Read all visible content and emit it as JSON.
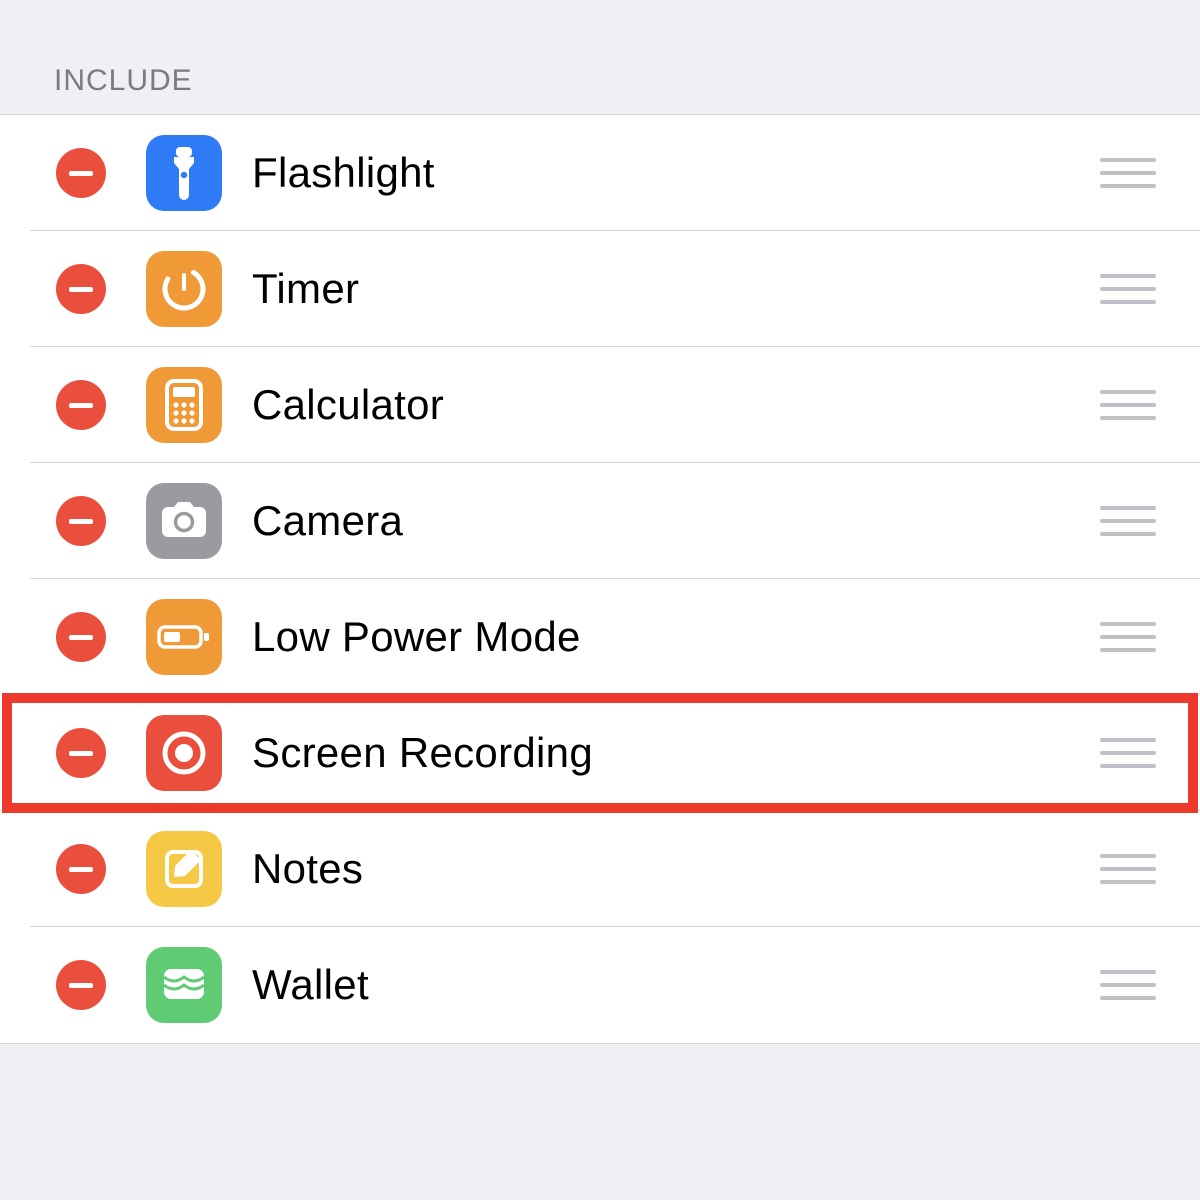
{
  "section": {
    "header": "INCLUDE"
  },
  "colors": {
    "remove": "#ea4e3d",
    "highlight": "#ee3a2c",
    "blue": "#2f7bf6",
    "orange": "#f09a37",
    "grey": "#9a9aa0",
    "red": "#ea4e3d",
    "yellow": "#f5c945",
    "green": "#60cb75"
  },
  "items": [
    {
      "id": "flashlight",
      "label": "Flashlight",
      "icon": "flashlight-icon",
      "icon_bg": "blue",
      "highlighted": false
    },
    {
      "id": "timer",
      "label": "Timer",
      "icon": "timer-icon",
      "icon_bg": "orange",
      "highlighted": false
    },
    {
      "id": "calculator",
      "label": "Calculator",
      "icon": "calculator-icon",
      "icon_bg": "orange",
      "highlighted": false
    },
    {
      "id": "camera",
      "label": "Camera",
      "icon": "camera-icon",
      "icon_bg": "grey",
      "highlighted": false
    },
    {
      "id": "low-power-mode",
      "label": "Low Power Mode",
      "icon": "battery-icon",
      "icon_bg": "orange",
      "highlighted": false
    },
    {
      "id": "screen-recording",
      "label": "Screen Recording",
      "icon": "screen-recording-icon",
      "icon_bg": "red",
      "highlighted": true
    },
    {
      "id": "notes",
      "label": "Notes",
      "icon": "notes-icon",
      "icon_bg": "yellow",
      "highlighted": false
    },
    {
      "id": "wallet",
      "label": "Wallet",
      "icon": "wallet-icon",
      "icon_bg": "green",
      "highlighted": false
    }
  ]
}
